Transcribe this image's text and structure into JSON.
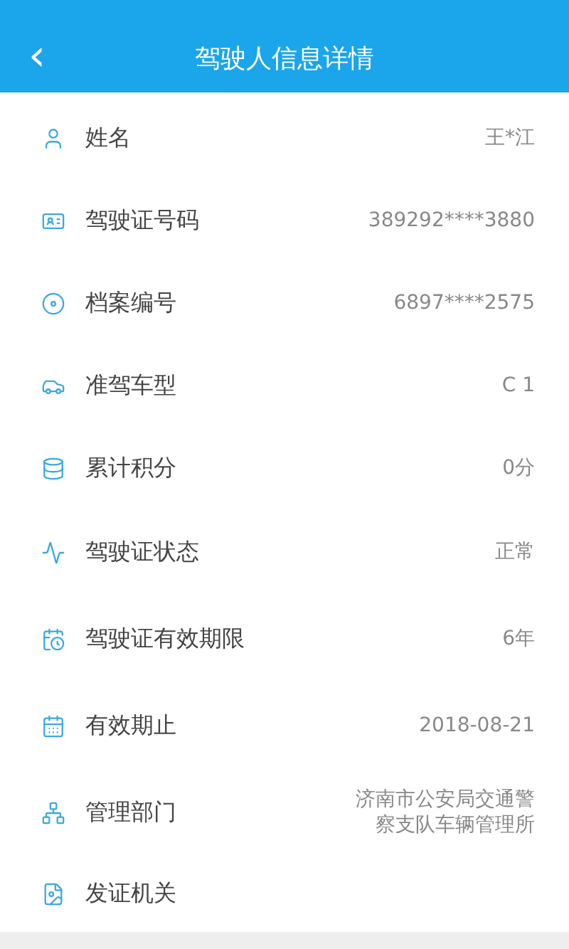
{
  "header": {
    "back": "‹",
    "title": "驾驶人信息详情"
  },
  "rows": [
    {
      "label": "姓名",
      "value": "王*江"
    },
    {
      "label": "驾驶证号码",
      "value": "389292****3880"
    },
    {
      "label": "档案编号",
      "value": "6897****2575"
    },
    {
      "label": "准驾车型",
      "value": "C 1"
    },
    {
      "label": "累计积分",
      "value": "0分"
    },
    {
      "label": "驾驶证状态",
      "value": "正常"
    },
    {
      "label": "驾驶证有效期限",
      "value": "6年"
    },
    {
      "label": "有效期止",
      "value": "2018-08-21"
    },
    {
      "label": "管理部门",
      "value": "济南市公安局交通警察支队车辆管理所"
    },
    {
      "label": "发证机关"
    }
  ]
}
